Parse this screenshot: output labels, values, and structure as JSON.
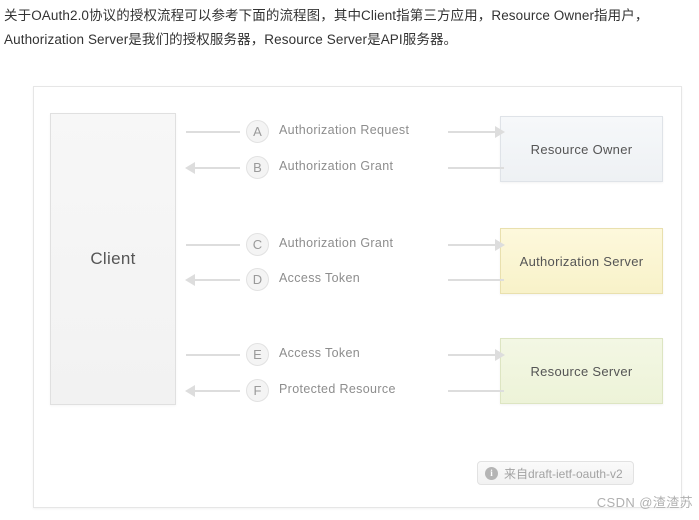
{
  "intro": {
    "line1": "关于OAuth2.0协议的授权流程可以参考下面的流程图，其中Client指第三方应用，Resource Owner指用户，",
    "line2": "Authorization Server是我们的授权服务器，Resource Server是API服务器。"
  },
  "diagram": {
    "client": {
      "label": "Client"
    },
    "entities": [
      {
        "key": "resource_owner",
        "label": "Resource Owner",
        "color": "#f6f8fa"
      },
      {
        "key": "authorization_server",
        "label": "Authorization Server",
        "color": "#fdf8dc"
      },
      {
        "key": "resource_server",
        "label": "Resource Server",
        "color": "#f3f7e4"
      }
    ],
    "flows": [
      {
        "step": "A",
        "label": "Authorization Request",
        "direction": "right"
      },
      {
        "step": "B",
        "label": "Authorization Grant",
        "direction": "left"
      },
      {
        "step": "C",
        "label": "Authorization Grant",
        "direction": "right"
      },
      {
        "step": "D",
        "label": "Access Token",
        "direction": "left"
      },
      {
        "step": "E",
        "label": "Access Token",
        "direction": "right"
      },
      {
        "step": "F",
        "label": "Protected Resource",
        "direction": "left"
      }
    ],
    "source_badge": {
      "icon": "info-icon",
      "text": "来自draft-ietf-oauth-v2"
    }
  },
  "watermark": {
    "text": "CSDN @渣渣苏"
  }
}
